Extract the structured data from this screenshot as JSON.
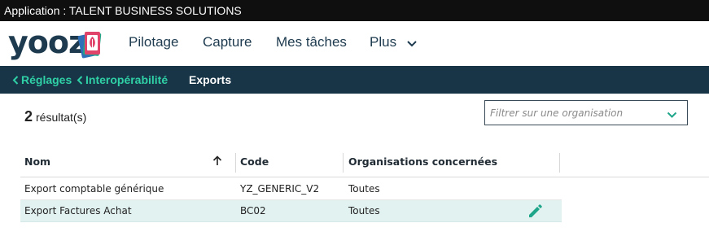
{
  "app_bar": {
    "title": "Application : TALENT BUSINESS SOLUTIONS"
  },
  "logo": {
    "text": "yooz",
    "icon": "yooz-logo"
  },
  "nav": {
    "items": [
      {
        "label": "Pilotage"
      },
      {
        "label": "Capture"
      },
      {
        "label": "Mes tâches"
      },
      {
        "label": "Plus",
        "icon": "chevron-down-icon"
      }
    ]
  },
  "breadcrumb": {
    "items": [
      {
        "label": "Réglages",
        "icon": "chevron-left-icon",
        "link": true
      },
      {
        "label": "Interopérabilité",
        "icon": "chevron-left-icon",
        "link": true
      },
      {
        "label": "Exports",
        "link": false
      }
    ]
  },
  "results": {
    "count": "2",
    "label": "résultat(s)"
  },
  "filter": {
    "placeholder": "Filtrer sur une organisation",
    "value": "",
    "icon": "chevron-down-icon"
  },
  "table": {
    "columns": [
      {
        "label": "Nom",
        "sort_icon": "arrow-up-icon"
      },
      {
        "label": "Code"
      },
      {
        "label": "Organisations concernées"
      }
    ],
    "rows": [
      {
        "nom": "Export comptable générique",
        "code": "YZ_GENERIC_V2",
        "organisations": "Toutes",
        "selected": false
      },
      {
        "nom": "Export Factures Achat",
        "code": "BC02",
        "organisations": "Toutes",
        "selected": true,
        "action_icon": "pencil-icon"
      }
    ]
  },
  "colors": {
    "app_bar": "#0f0f10",
    "breadcrumb_bg": "#183447",
    "accent": "#2fd0a6",
    "edit_icon": "#1fa58a",
    "selected_row": "#e2f2f1",
    "nav_text": "#1d3a4e"
  }
}
